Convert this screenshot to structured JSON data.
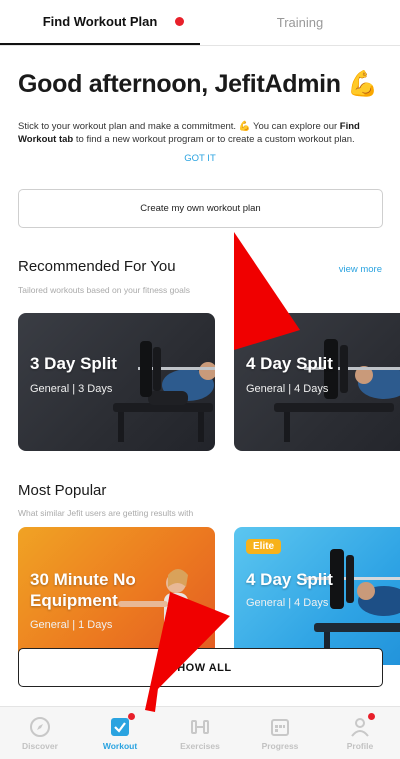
{
  "tabs": [
    {
      "label": "Find Workout Plan",
      "active": true
    },
    {
      "label": "Training",
      "active": false
    }
  ],
  "greeting": "Good afternoon, JefitAdmin 💪",
  "intro": {
    "text_before": "Stick to your workout plan and make a commitment. 💪 You can explore our ",
    "bold": "Find Workout tab",
    "text_after": " to find a new workout program or to create a custom workout plan."
  },
  "got_it": "GOT IT",
  "create_plan_label": "Create my own workout plan",
  "recommended": {
    "title": "Recommended For You",
    "subtitle": "Tailored workouts based on your fitness goals",
    "view_more": "view more",
    "cards": [
      {
        "title": "3 Day Split",
        "meta": "General | 3 Days"
      },
      {
        "title": "4 Day Split",
        "meta": "General | 4 Days"
      }
    ]
  },
  "popular": {
    "title": "Most Popular",
    "subtitle": "What similar Jefit users are getting results with",
    "cards": [
      {
        "title_line1": "30 Minute No",
        "title_line2": "Equipment",
        "meta": "General | 1 Days"
      },
      {
        "badge": "Elite",
        "title": "4 Day Split",
        "meta": "General | 4 Days"
      }
    ]
  },
  "show_all_label": "SHOW ALL",
  "bottom_nav": [
    {
      "label": "Discover",
      "icon": "compass-icon"
    },
    {
      "label": "Workout",
      "icon": "checkbox-icon",
      "active": true
    },
    {
      "label": "Exercises",
      "icon": "dumbbell-icon"
    },
    {
      "label": "Progress",
      "icon": "calendar-icon"
    },
    {
      "label": "Profile",
      "icon": "person-icon"
    }
  ],
  "colors": {
    "accent": "#2aa3e0",
    "notification": "#e8202a",
    "badge": "#f7b21b"
  }
}
